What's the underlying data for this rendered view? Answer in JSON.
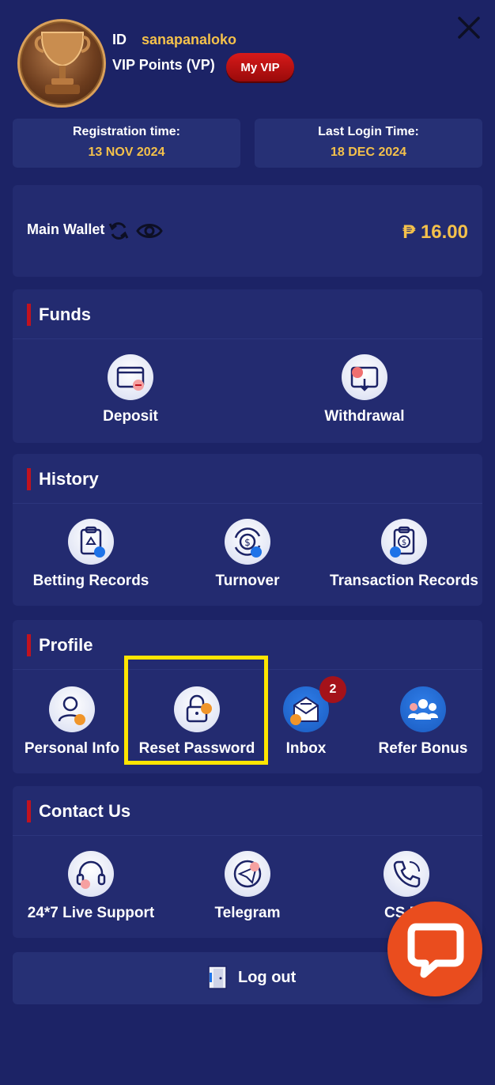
{
  "header": {
    "id_label": "ID",
    "username": "sanapanaloko",
    "vip_points_label": "VIP Points (VP)",
    "my_vip_button": "My VIP",
    "close_icon": "close-icon"
  },
  "registration": {
    "label": "Registration time:",
    "value": "13 NOV 2024"
  },
  "last_login": {
    "label": "Last Login Time:",
    "value": "18 DEC 2024"
  },
  "wallet": {
    "label": "Main Wallet",
    "amount": "₱ 16.00",
    "icons": [
      "refresh-icon",
      "eye-icon"
    ]
  },
  "funds": {
    "title": "Funds",
    "items": [
      {
        "label": "Deposit",
        "icon": "deposit-card-icon"
      },
      {
        "label": "Withdrawal",
        "icon": "withdrawal-card-icon"
      }
    ]
  },
  "history": {
    "title": "History",
    "items": [
      {
        "label": "Betting Records",
        "icon": "betting-records-icon"
      },
      {
        "label": "Turnover",
        "icon": "turnover-icon"
      },
      {
        "label": "Transaction Records",
        "icon": "transaction-records-icon"
      }
    ]
  },
  "profile": {
    "title": "Profile",
    "items": [
      {
        "label": "Personal Info",
        "icon": "user-icon"
      },
      {
        "label": "Reset Password",
        "icon": "lock-icon"
      },
      {
        "label": "Inbox",
        "icon": "mail-icon",
        "badge": "2"
      },
      {
        "label": "Refer Bonus",
        "icon": "group-icon"
      }
    ]
  },
  "contact": {
    "title": "Contact Us",
    "items": [
      {
        "label": "24*7 Live Support",
        "icon": "headset-icon"
      },
      {
        "label": "Telegram",
        "icon": "telegram-icon"
      },
      {
        "label": "CS Ph",
        "icon": "phone-icon"
      }
    ]
  },
  "logout": {
    "label": "Log out",
    "icon": "logout-door-icon"
  },
  "chat": {
    "icon": "chat-bubble-icon"
  },
  "colors": {
    "background": "#1c2366",
    "panel": "#232b70",
    "accent_gold": "#f4c14b",
    "accent_red": "#c1121f",
    "highlight": "#ffe500",
    "chat_orange": "#ea4d1e"
  }
}
